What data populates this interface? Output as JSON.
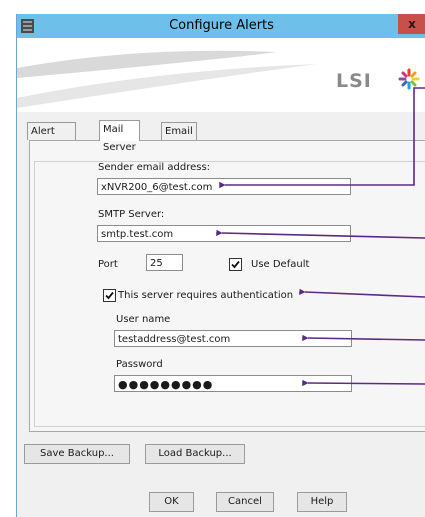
{
  "window": {
    "title": "Configure Alerts",
    "close_label": "x"
  },
  "banner": {
    "logo_text": "LSI"
  },
  "tabs": [
    {
      "label": "Alert Settings"
    },
    {
      "label": "Mail Server"
    },
    {
      "label": "Email"
    }
  ],
  "form": {
    "sender_label": "Sender email address:",
    "sender_value": "xNVR200_6@test.com",
    "smtp_label": "SMTP Server:",
    "smtp_value": "smtp.test.com",
    "port_label": "Port",
    "port_value": "25",
    "use_default_label": "Use Default",
    "use_default_checked": true,
    "auth_label": "This server requires authentication",
    "auth_checked": true,
    "username_label": "User name",
    "username_value": "testaddress@test.com",
    "password_label": "Password",
    "password_value": "●●●●●●●●●"
  },
  "buttons": {
    "save_backup": "Save Backup...",
    "load_backup": "Load Backup...",
    "ok": "OK",
    "cancel": "Cancel",
    "help": "Help"
  },
  "colors": {
    "titlebar": "#6ec0ea",
    "annotation": "#5b2a86",
    "close": "#c7504b"
  }
}
